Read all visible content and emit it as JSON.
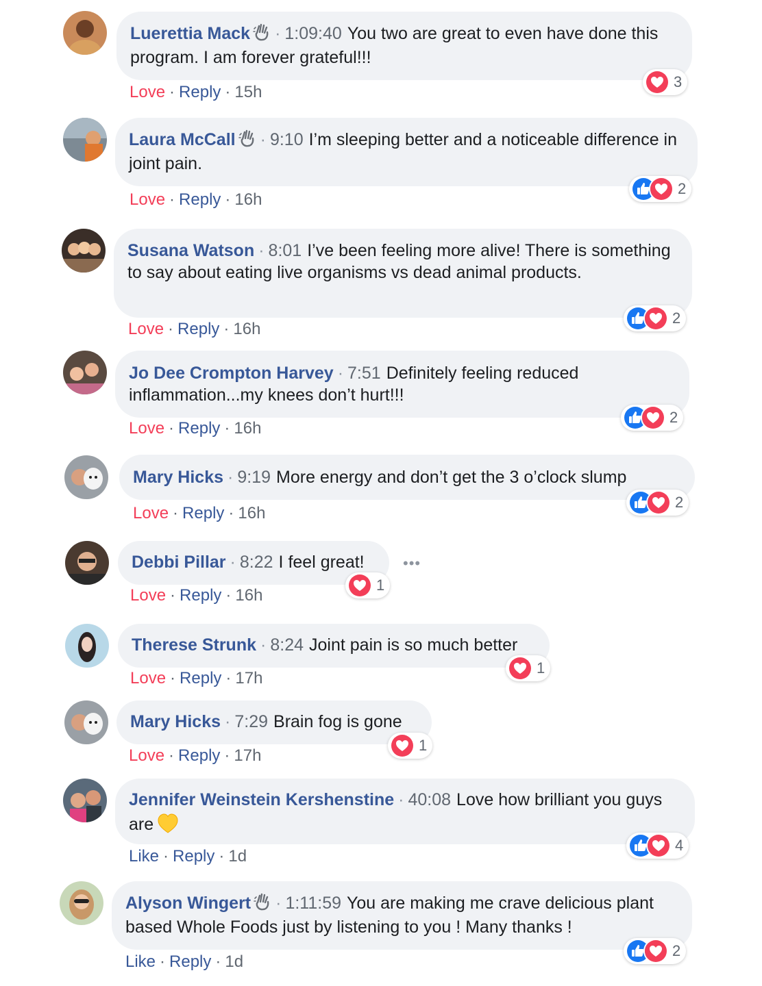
{
  "separator": "·",
  "comments": [
    {
      "name": "Luerettia Mack",
      "time": "1:09:40",
      "text": "You two are great to even have done this program. I am forever grateful!!!",
      "action": "Love",
      "reply": "Reply",
      "age": "15h",
      "reaction_count": "3",
      "reactions": [
        "love"
      ],
      "wave": true
    },
    {
      "name": "Laura McCall",
      "time": "9:10",
      "text": "I’m sleeping better and a noticeable difference in joint pain.",
      "action": "Love",
      "reply": "Reply",
      "age": "16h",
      "reaction_count": "2",
      "reactions": [
        "like",
        "love"
      ],
      "wave": true
    },
    {
      "name": "Susana Watson",
      "time": "8:01",
      "text": "I’ve been feeling more alive! There is something to say about eating live organisms vs dead animal products.",
      "action": "Love",
      "reply": "Reply",
      "age": "16h",
      "reaction_count": "2",
      "reactions": [
        "like",
        "love"
      ],
      "wave": false
    },
    {
      "name": "Jo Dee Crompton Harvey",
      "time": "7:51",
      "text": "Definitely feeling reduced inflammation...my knees don’t hurt!!!",
      "action": "Love",
      "reply": "Reply",
      "age": "16h",
      "reaction_count": "2",
      "reactions": [
        "like",
        "love"
      ],
      "wave": false
    },
    {
      "name": "Mary Hicks",
      "time": "9:19",
      "text": "More energy and don’t get the 3 o’clock slump",
      "action": "Love",
      "reply": "Reply",
      "age": "16h",
      "reaction_count": "2",
      "reactions": [
        "like",
        "love"
      ],
      "wave": false
    },
    {
      "name": "Debbi Pillar",
      "time": "8:22",
      "text": "I feel great!",
      "action": "Love",
      "reply": "Reply",
      "age": "16h",
      "reaction_count": "1",
      "reactions": [
        "love"
      ],
      "wave": false,
      "more": "•••"
    },
    {
      "name": "Therese Strunk",
      "time": "8:24",
      "text": "Joint pain is so much better",
      "action": "Love",
      "reply": "Reply",
      "age": "17h",
      "reaction_count": "1",
      "reactions": [
        "love"
      ],
      "wave": false
    },
    {
      "name": "Mary Hicks",
      "time": "7:29",
      "text": "Brain fog is gone",
      "action": "Love",
      "reply": "Reply",
      "age": "17h",
      "reaction_count": "1",
      "reactions": [
        "love"
      ],
      "wave": false
    },
    {
      "name": "Jennifer Weinstein Kershenstine",
      "time": "40:08",
      "text": "Love how brilliant you guys are",
      "emoji": "yellow-heart",
      "action": "Like",
      "reply": "Reply",
      "age": "1d",
      "reaction_count": "4",
      "reactions": [
        "like",
        "love"
      ],
      "wave": false
    },
    {
      "name": "Alyson Wingert",
      "time": "1:11:59",
      "text": "You are making me crave delicious plant based Whole Foods just by listening to you ! Many thanks !",
      "action": "Like",
      "reply": "Reply",
      "age": "1d",
      "reaction_count": "2",
      "reactions": [
        "like",
        "love"
      ],
      "wave": true
    }
  ],
  "colors": {
    "name": "#385898",
    "love": "#f33e58",
    "like": "#1877f2",
    "bubble": "#f0f2f5",
    "meta": "#606770"
  }
}
